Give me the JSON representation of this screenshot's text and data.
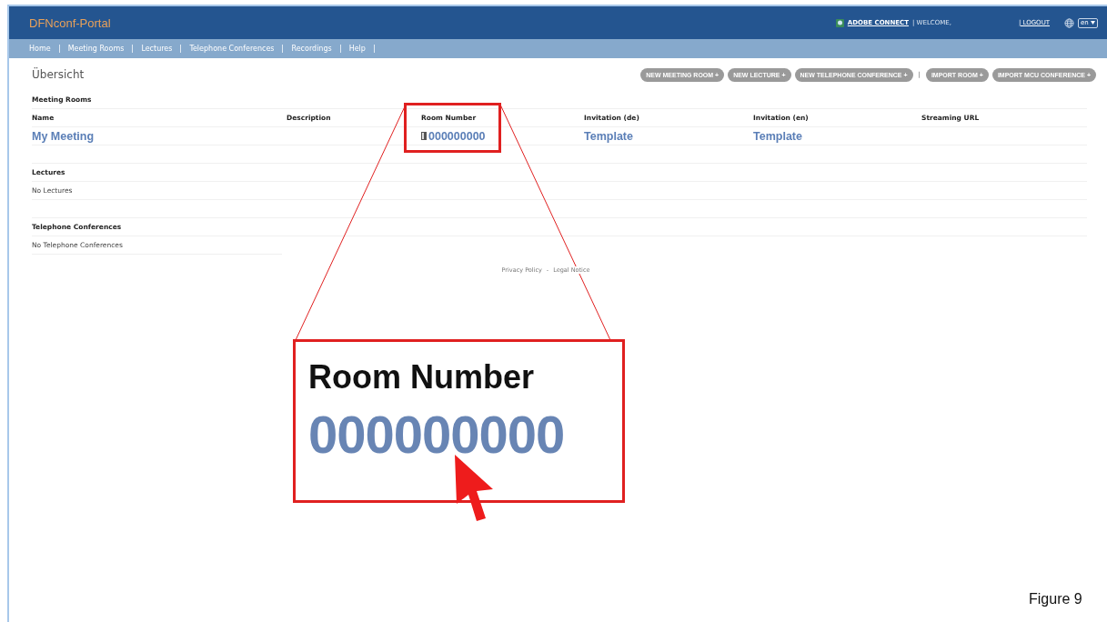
{
  "header": {
    "title": "DFNconf-Portal",
    "adobe_connect": "ADOBE CONNECT",
    "welcome": "| WELCOME,",
    "logout": "| LOGOUT",
    "language": "en"
  },
  "nav": [
    "Home",
    "Meeting Rooms",
    "Lectures",
    "Telephone Conferences",
    "Recordings",
    "Help"
  ],
  "page_title": "Übersicht",
  "actions": [
    {
      "label": "NEW MEETING ROOM +",
      "kind": "button"
    },
    {
      "label": "NEW LECTURE +",
      "kind": "button"
    },
    {
      "label": "NEW TELEPHONE CONFERENCE +",
      "kind": "button"
    },
    {
      "label": "|",
      "kind": "separator"
    },
    {
      "label": "IMPORT ROOM +",
      "kind": "button"
    },
    {
      "label": "IMPORT MCU CONFERENCE +",
      "kind": "button"
    }
  ],
  "meeting_rooms": {
    "title": "Meeting Rooms",
    "columns": [
      "Name",
      "Description",
      "Room Number",
      "Invitation (de)",
      "Invitation (en)",
      "Streaming URL"
    ],
    "rows": [
      {
        "name": "My Meeting",
        "room_number": "000000000",
        "invitation_de": "Template",
        "invitation_en": "Template"
      }
    ]
  },
  "lectures": {
    "title": "Lectures",
    "empty": "No Lectures"
  },
  "telephone_conferences": {
    "title": "Telephone Conferences",
    "empty": "No Telephone Conferences"
  },
  "footer": [
    "Privacy Policy",
    "-",
    "Legal Notice"
  ],
  "callout": {
    "label": "Room Number",
    "value": "000000000"
  },
  "caption": "Figure 9"
}
